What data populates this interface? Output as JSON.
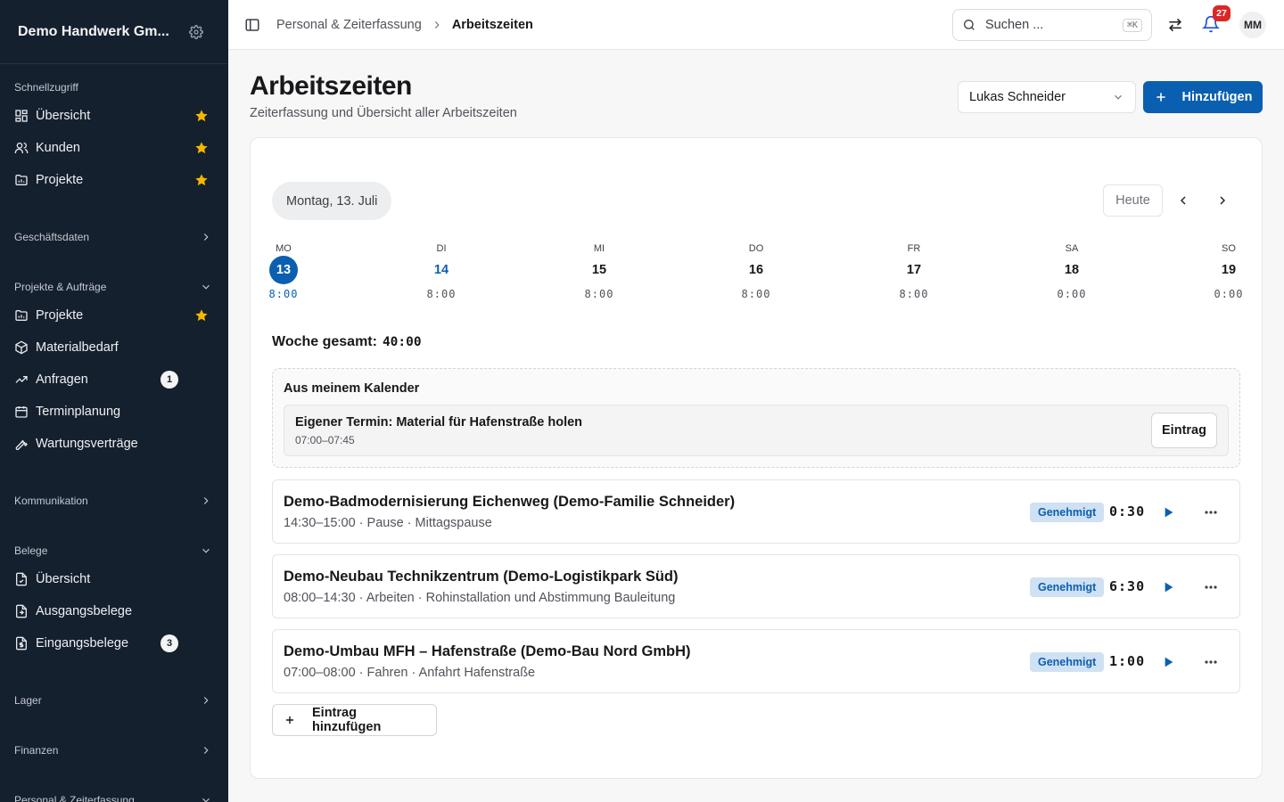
{
  "sidebar": {
    "company": "Demo Handwerk Gm...",
    "quick_title": "Schnellzugriff",
    "quick_items": [
      {
        "label": "Übersicht"
      },
      {
        "label": "Kunden"
      },
      {
        "label": "Projekte"
      }
    ],
    "sec_geschaeft": "Geschäftsdaten",
    "sec_projekte": "Projekte & Aufträge",
    "projekte_items": [
      {
        "label": "Projekte"
      },
      {
        "label": "Materialbedarf"
      },
      {
        "label": "Anfragen",
        "count": "1"
      },
      {
        "label": "Terminplanung"
      },
      {
        "label": "Wartungsverträge"
      }
    ],
    "sec_kommunikation": "Kommunikation",
    "sec_belege": "Belege",
    "belege_items": [
      {
        "label": "Übersicht"
      },
      {
        "label": "Ausgangsbelege"
      },
      {
        "label": "Eingangsbelege",
        "count": "3"
      }
    ],
    "sec_lager": "Lager",
    "sec_finanzen": "Finanzen",
    "sec_personal": "Personal & Zeiterfassung"
  },
  "topbar": {
    "breadcrumb_parent": "Personal & Zeiterfassung",
    "breadcrumb_current": "Arbeitszeiten",
    "search_placeholder": "Suchen ...",
    "search_shortcut": "⌘K",
    "notification_count": "27",
    "avatar_initials": "MM"
  },
  "page": {
    "title": "Arbeitszeiten",
    "subtitle": "Zeiterfassung und Übersicht aller Arbeitszeiten",
    "employee": "Lukas Schneider",
    "add_label": "Hinzufügen"
  },
  "calendar": {
    "selected_date": "Montag, 13. Juli",
    "today_label": "Heute",
    "days": [
      {
        "name": "MO",
        "date": "13",
        "hours": "8:00"
      },
      {
        "name": "DI",
        "date": "14",
        "hours": "8:00"
      },
      {
        "name": "MI",
        "date": "15",
        "hours": "8:00"
      },
      {
        "name": "DO",
        "date": "16",
        "hours": "8:00"
      },
      {
        "name": "FR",
        "date": "17",
        "hours": "8:00"
      },
      {
        "name": "SA",
        "date": "18",
        "hours": "0:00"
      },
      {
        "name": "SO",
        "date": "19",
        "hours": "0:00"
      }
    ],
    "week_total_label": "Woche gesamt:",
    "week_total_value": "40:00"
  },
  "own_calendar": {
    "title": "Aus meinem Kalender",
    "entry_title": "Eigener Termin: Material für Hafenstraße holen",
    "entry_time": "07:00–07:45",
    "entry_button": "Eintrag"
  },
  "entries": [
    {
      "title": "Demo-Badmodernisierung Eichenweg (Demo-Familie Schneider)",
      "detail": "14:30–15:00 · Pause · Mittagspause",
      "status": "Genehmigt",
      "duration": "0:30"
    },
    {
      "title": "Demo-Neubau Technikzentrum (Demo-Logistikpark Süd)",
      "detail": "08:00–14:30 · Arbeiten · Rohinstallation und Abstimmung Bauleitung",
      "status": "Genehmigt",
      "duration": "6:30"
    },
    {
      "title": "Demo-Umbau MFH – Hafenstraße (Demo-Bau Nord GmbH)",
      "detail": "07:00–08:00 · Fahren · Anfahrt Hafenstraße",
      "status": "Genehmigt",
      "duration": "1:00"
    }
  ],
  "add_entry_label": "Eintrag hinzufügen",
  "colors": {
    "sidebar_bg": "#15202e",
    "accent": "#0b5fb0",
    "star": "#f5b800",
    "badge_bg": "#cfe1f3"
  }
}
